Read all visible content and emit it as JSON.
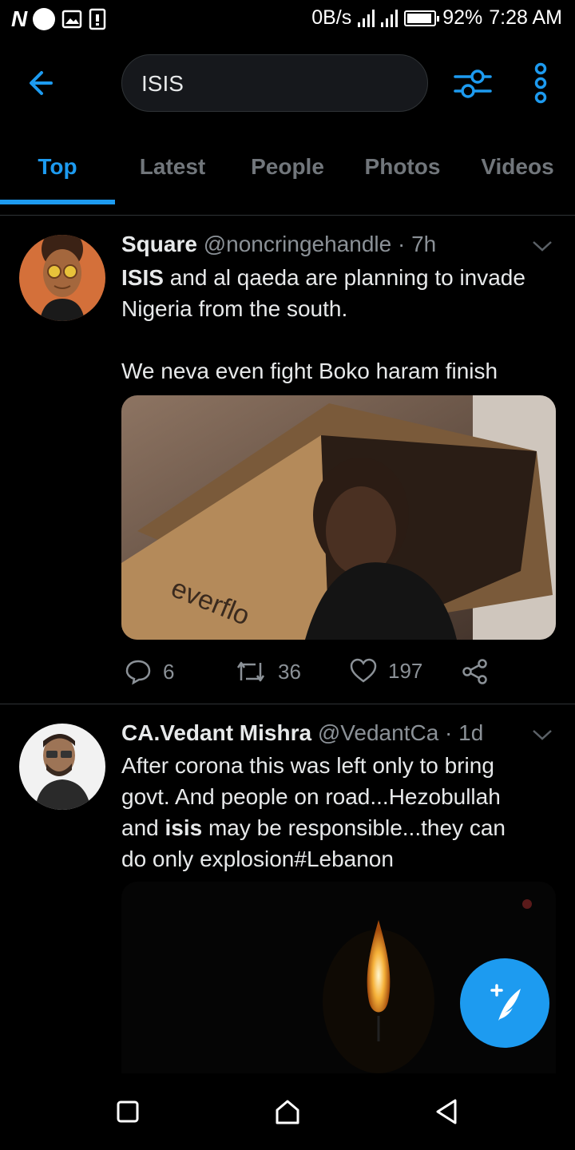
{
  "status_bar": {
    "left_icons": [
      "N",
      "notification-dot-icon",
      "image-icon",
      "sim-icon"
    ],
    "net_speed": "0B/s",
    "battery": "92%",
    "time": "7:28 AM"
  },
  "header": {
    "search_value": "ISIS",
    "icons": [
      "back-arrow-icon",
      "filter-icon",
      "more-vertical-icon"
    ]
  },
  "tabs": [
    {
      "label": "Top",
      "active": true
    },
    {
      "label": "Latest",
      "active": false
    },
    {
      "label": "People",
      "active": false
    },
    {
      "label": "Photos",
      "active": false
    },
    {
      "label": "Videos",
      "active": false
    }
  ],
  "tweets": [
    {
      "name": "Square",
      "handle": "@noncringehandle",
      "dot": "·",
      "time": "7h",
      "text_lines": [
        [
          {
            "t": "ISIS",
            "b": true
          },
          {
            "t": " and al qaeda are planning to invade",
            "b": false
          }
        ],
        [
          {
            "t": "Nigeria from the south.",
            "b": false
          }
        ],
        [
          {
            "t": "",
            "b": false
          }
        ],
        [
          {
            "t": "We neva even fight Boko haram finish",
            "b": false
          }
        ]
      ],
      "media_text": "everflo",
      "replies": "6",
      "retweets": "36",
      "likes": "197"
    },
    {
      "name": "CA.Vedant Mishra",
      "handle": "@VedantCa",
      "dot": "·",
      "time": "1d",
      "text_lines": [
        [
          {
            "t": "After corona this was left only to bring",
            "b": false
          }
        ],
        [
          {
            "t": "govt. And people on road...Hezobullah",
            "b": false
          }
        ],
        [
          {
            "t": "and ",
            "b": false
          },
          {
            "t": "isis",
            "b": true
          },
          {
            "t": " may be responsible...they can",
            "b": false
          }
        ],
        [
          {
            "t": "do only explosion#Lebanon",
            "b": false
          }
        ]
      ]
    }
  ],
  "colors": {
    "accent": "#1d9bf0",
    "background": "#000000",
    "muted": "#71767b",
    "divider": "#2f3336"
  },
  "fab": {
    "icon": "compose-tweet-icon"
  },
  "nav_bar": {
    "icons": [
      "recents-square-icon",
      "home-icon",
      "back-triangle-icon"
    ]
  }
}
